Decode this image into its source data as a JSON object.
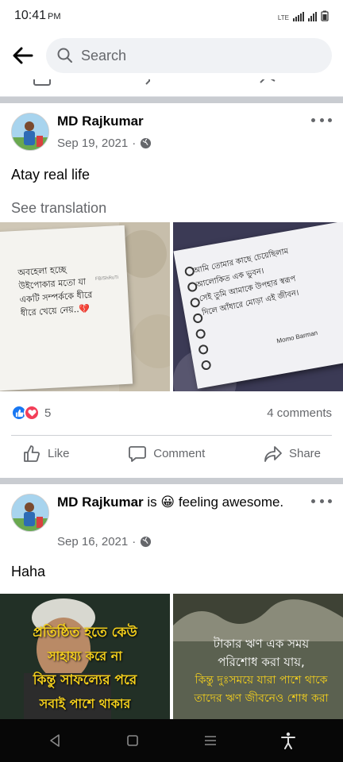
{
  "status_bar": {
    "time": "10:41",
    "ampm": "PM",
    "network": "LTE"
  },
  "search": {
    "placeholder": "Search"
  },
  "posts": [
    {
      "author": "MD Rajkumar",
      "date": "Sep 19, 2021",
      "separator": "·",
      "privacy_icon": "globe-icon",
      "text": "Atay real life",
      "see_translation": "See translation",
      "photos": [
        {
          "caption_lines": [
            "অবহেলা হচ্ছে",
            "উইপোকার মতো যা",
            "একটি সম্পর্ককে ধীরে",
            "ধীরে খেয়ে নেয়..💔"
          ],
          "watermark": "FB/ShRuTi"
        },
        {
          "caption_lines": [
            "আমি তোমার কাছে চেয়েছিলাম",
            "আলোকিত এক ভুবন।",
            "সেই তুমি আমাকে উপহার স্বরূপ",
            "দিলে আঁধারে মোড়া এই জীবন।"
          ],
          "signature": "Momo Barman"
        }
      ],
      "reaction_count": "5",
      "comments": "4 comments",
      "actions": {
        "like": "Like",
        "comment": "Comment",
        "share": "Share"
      }
    },
    {
      "author": "MD Rajkumar",
      "is_text": "is",
      "feeling_emoji": "😀",
      "feeling_text": "feeling awesome.",
      "date": "Sep 16, 2021",
      "separator": "·",
      "privacy_icon": "globe-icon",
      "text": "Haha",
      "photos": [
        {
          "caption_lines": [
            "প্রতিষ্ঠিত হতে কেউ",
            "সাহায্য করে না",
            "কিন্তু সাফল্যের পরে",
            "সবাই পাশে থাকার"
          ]
        },
        {
          "caption_lines": [
            "টাকার ঋণ এক সময়",
            "পরিশোধ করা যায়,",
            "কিন্তু দুঃসময়ে যারা পাশে থাকে",
            "তাদের ঋণ জীবনেও শোধ করা"
          ]
        }
      ]
    }
  ],
  "colors": {
    "accent_blue": "#1877f2",
    "love_red": "#f33e58",
    "secondary_text": "#65676b",
    "divider": "#c9ccd1"
  }
}
